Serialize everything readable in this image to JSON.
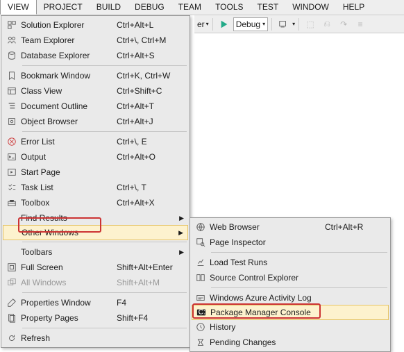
{
  "menubar": [
    "VIEW",
    "PROJECT",
    "BUILD",
    "DEBUG",
    "TEAM",
    "TOOLS",
    "TEST",
    "WINDOW",
    "HELP"
  ],
  "menubar_open_index": 0,
  "toolbar": {
    "er_suffix": "er",
    "debug_label": "Debug"
  },
  "view_menu": [
    {
      "t": "item",
      "icon": "solution",
      "label": "Solution Explorer",
      "sc": "Ctrl+Alt+L"
    },
    {
      "t": "item",
      "icon": "team",
      "label": "Team Explorer",
      "sc": "Ctrl+\\, Ctrl+M"
    },
    {
      "t": "item",
      "icon": "database",
      "label": "Database Explorer",
      "sc": "Ctrl+Alt+S"
    },
    {
      "t": "sep"
    },
    {
      "t": "item",
      "icon": "bookmark",
      "label": "Bookmark Window",
      "sc": "Ctrl+K, Ctrl+W"
    },
    {
      "t": "item",
      "icon": "class",
      "label": "Class View",
      "sc": "Ctrl+Shift+C"
    },
    {
      "t": "item",
      "icon": "outline",
      "label": "Document Outline",
      "sc": "Ctrl+Alt+T"
    },
    {
      "t": "item",
      "icon": "object",
      "label": "Object Browser",
      "sc": "Ctrl+Alt+J"
    },
    {
      "t": "sep"
    },
    {
      "t": "item",
      "icon": "error",
      "label": "Error List",
      "sc": "Ctrl+\\, E"
    },
    {
      "t": "item",
      "icon": "output",
      "label": "Output",
      "sc": "Ctrl+Alt+O"
    },
    {
      "t": "item",
      "icon": "start",
      "label": "Start Page",
      "sc": ""
    },
    {
      "t": "item",
      "icon": "task",
      "label": "Task List",
      "sc": "Ctrl+\\, T"
    },
    {
      "t": "item",
      "icon": "toolbox",
      "label": "Toolbox",
      "sc": "Ctrl+Alt+X"
    },
    {
      "t": "sub",
      "icon": "",
      "label": "Find Results",
      "sc": ""
    },
    {
      "t": "sub",
      "icon": "",
      "label": "Other Windows",
      "sc": "",
      "hov": true,
      "boxed": true
    },
    {
      "t": "sep"
    },
    {
      "t": "sub",
      "icon": "",
      "label": "Toolbars",
      "sc": ""
    },
    {
      "t": "item",
      "icon": "fullscreen",
      "label": "Full Screen",
      "sc": "Shift+Alt+Enter"
    },
    {
      "t": "item",
      "icon": "allwin",
      "label": "All Windows",
      "sc": "Shift+Alt+M",
      "dis": true
    },
    {
      "t": "sep"
    },
    {
      "t": "item",
      "icon": "prop",
      "label": "Properties Window",
      "sc": "F4"
    },
    {
      "t": "item",
      "icon": "pages",
      "label": "Property Pages",
      "sc": "Shift+F4"
    },
    {
      "t": "sep"
    },
    {
      "t": "item",
      "icon": "refresh",
      "label": "Refresh",
      "sc": ""
    }
  ],
  "other_windows": [
    {
      "icon": "web",
      "label": "Web Browser",
      "sc": "Ctrl+Alt+R"
    },
    {
      "icon": "inspect",
      "label": "Page Inspector",
      "sc": ""
    },
    {
      "t": "sep"
    },
    {
      "icon": "load",
      "label": "Load Test Runs",
      "sc": ""
    },
    {
      "icon": "source",
      "label": "Source Control Explorer",
      "sc": ""
    },
    {
      "t": "sep"
    },
    {
      "icon": "azure",
      "label": "Windows Azure Activity Log",
      "sc": ""
    },
    {
      "icon": "console",
      "label": "Package Manager Console",
      "sc": "",
      "hov": true,
      "boxed": true
    },
    {
      "icon": "history",
      "label": "History",
      "sc": ""
    },
    {
      "icon": "pending",
      "label": "Pending Changes",
      "sc": ""
    }
  ]
}
